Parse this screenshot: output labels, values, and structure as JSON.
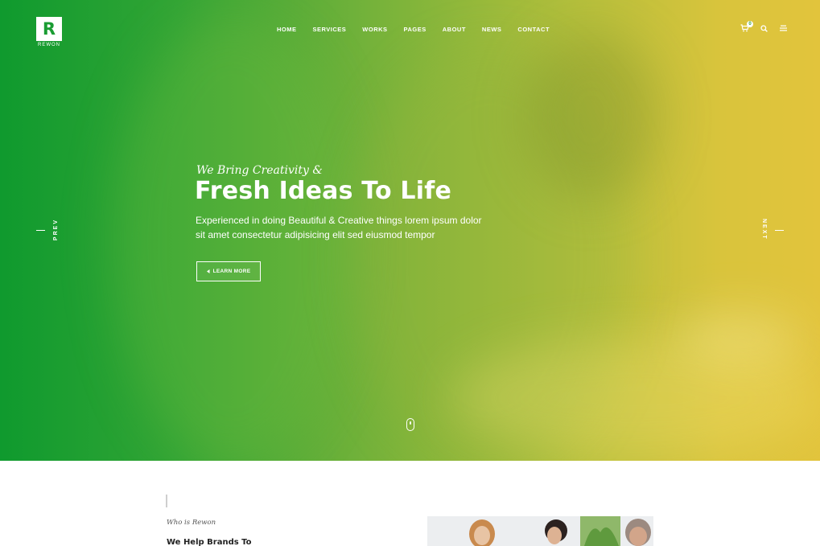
{
  "logo": {
    "letter": "R",
    "name": "REWON"
  },
  "nav": {
    "items": [
      "HOME",
      "SERVICES",
      "WORKS",
      "PAGES",
      "ABOUT",
      "NEWS",
      "CONTACT"
    ]
  },
  "header": {
    "cart_count": "0",
    "icons": [
      "cart-icon",
      "search-icon",
      "menu-icon"
    ]
  },
  "hero": {
    "kicker": "We Bring Creativity &",
    "title": "Fresh Ideas To Life",
    "description": "Experienced in doing Beautiful & Creative things lorem ipsum dolor sit amet consectetur adipisicing elit sed eiusmod tempor",
    "button_label": "LEARN MORE",
    "prev_label": "PREV",
    "next_label": "NEXT",
    "gradient_colors": [
      "#0f9a2e",
      "#74b23a",
      "#e2c43c"
    ]
  },
  "about": {
    "kicker": "Who is Rewon",
    "title": "We Help Brands To"
  }
}
